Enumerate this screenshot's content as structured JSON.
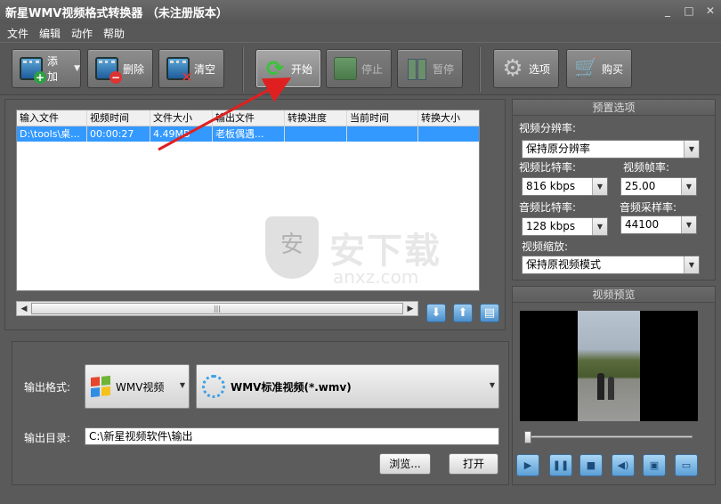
{
  "window": {
    "title": "新星WMV视频格式转换器 （未注册版本）",
    "controls": [
      "_",
      "□",
      "✕"
    ]
  },
  "menu": [
    "文件",
    "编辑",
    "动作",
    "帮助"
  ],
  "toolbar": {
    "add": "添加",
    "delete": "删除",
    "clear": "清空",
    "start": "开始",
    "stop": "停止",
    "pause": "暂停",
    "options": "选项",
    "buy": "购买"
  },
  "table": {
    "columns": [
      "输入文件",
      "视频时间",
      "文件大小",
      "输出文件",
      "转换进度",
      "当前时间",
      "转换大小"
    ],
    "rows": [
      [
        "D:\\tools\\桌...",
        "00:00:27",
        "4.49MB",
        "老板偶遇...",
        "",
        "",
        ""
      ]
    ]
  },
  "presets": {
    "title": "预置选项",
    "video_resolution_label": "视频分辨率:",
    "video_resolution": "保持原分辨率",
    "video_bitrate_label": "视频比特率:",
    "video_bitrate": "816 kbps",
    "video_fps_label": "视频帧率:",
    "video_fps": "25.00",
    "audio_bitrate_label": "音频比特率:",
    "audio_bitrate": "128 kbps",
    "audio_samplerate_label": "音频采样率:",
    "audio_samplerate": "44100",
    "video_scale_label": "视频缩放:",
    "video_scale": "保持原视频模式"
  },
  "preview": {
    "title": "视频预览",
    "progress": 0
  },
  "output": {
    "format_label": "输出格式:",
    "format": "WMV视频",
    "profile": "WMV标准视频(*.wmv)",
    "dir_label": "输出目录:",
    "dir": "C:\\新星视频软件\\输出",
    "browse": "浏览...",
    "open": "打开"
  },
  "watermark": {
    "text": "安下载",
    "sub": "anxz.com",
    "glyph": "安"
  },
  "colors": {
    "selected_row": "#3399ff",
    "accent_arrow": "#e02020"
  }
}
